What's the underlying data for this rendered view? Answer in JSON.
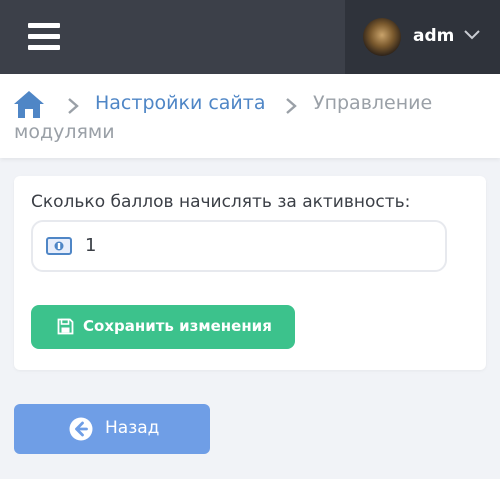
{
  "header": {
    "user_name": "adm",
    "colors": {
      "topbar": "#3c4049",
      "user_box": "#2f333b"
    },
    "icons": {
      "menu": "hamburger-icon",
      "dropdown": "chevron-down-icon"
    }
  },
  "breadcrumb": {
    "home_icon": "home-icon",
    "items": [
      {
        "label": "Настройки сайта"
      }
    ],
    "current_line1": "Управление",
    "current_line2": "модулями",
    "colors": {
      "link": "#4f86c6",
      "current": "#9aa0a7"
    }
  },
  "form": {
    "label": "Сколько баллов начислять за активность:",
    "points_value": "1",
    "input_icon": "money-icon",
    "save_label": "Сохранить изменения",
    "save_icon": "save-icon",
    "colors": {
      "save": "#3cc28c"
    }
  },
  "back": {
    "label": "Назад",
    "icon": "arrow-left-circle-icon",
    "colors": {
      "button": "#6f9ee6"
    }
  }
}
